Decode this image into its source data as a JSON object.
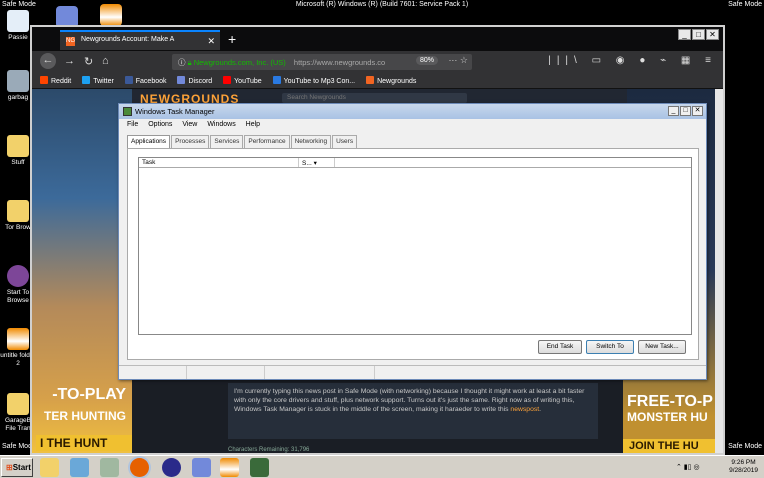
{
  "os": {
    "safe_mode": "Safe Mode",
    "build": "Microsoft (R) Windows (R) (Build 7601: Service Pack 1)"
  },
  "desktop_icons": [
    {
      "label": "Passie",
      "icon": "desktop-app-icon"
    },
    {
      "label": "garbag",
      "icon": "recycle-bin-icon"
    },
    {
      "label": "Stuff",
      "icon": "folder-icon"
    },
    {
      "label": "Tor Brow",
      "icon": "tor-browser-icon"
    },
    {
      "label": "Start To Browse",
      "icon": "tor-start-icon"
    },
    {
      "label": "untitle folder 2",
      "icon": "vlc-icon"
    },
    {
      "label": "GarageB File Tran",
      "icon": "folder-icon"
    }
  ],
  "firefox": {
    "tab_title": "Newgrounds Account: Make A",
    "tab_favicon": "NG",
    "secure_label": "Newgrounds.com, Inc. (US)",
    "url": "https://www.newgrounds.co",
    "zoom": "80%",
    "bookmarks": [
      {
        "label": "Reddit",
        "color": "#ff4500"
      },
      {
        "label": "Twitter",
        "color": "#1da1f2"
      },
      {
        "label": "Facebook",
        "color": "#3b5998"
      },
      {
        "label": "Discord",
        "color": "#7289da"
      },
      {
        "label": "YouTube",
        "color": "#ff0000"
      },
      {
        "label": "YouTube to Mp3 Con...",
        "color": "#2a7ae2"
      },
      {
        "label": "Newgrounds",
        "color": "#f26522"
      }
    ]
  },
  "page": {
    "logo": "NEWGROUNDS",
    "search_placeholder": "Search Newgrounds",
    "promo_left": [
      "-TO-PLAY",
      "TER HUNTING",
      "I THE HUNT"
    ],
    "promo_right": [
      "FREE-TO-P",
      "MONSTER HU",
      "JOIN THE HU"
    ],
    "news_text": "I'm currently typing this news post in Safe Mode (with networking) because I thought it might work at least a bit faster with only the core drivers and stuff, plus network support. Turns out it's just the same. Right now as of writing this, Windows Task Manager is stuck in the middle of the screen, making it haraeder to write this",
    "news_link": "newspost",
    "news_end": ".",
    "chars_remaining": "Characters Remaining: 31,796"
  },
  "taskmgr": {
    "title": "Windows Task Manager",
    "menu": [
      "File",
      "Options",
      "View",
      "Windows",
      "Help"
    ],
    "tabs": [
      "Applications",
      "Processes",
      "Services",
      "Performance",
      "Networking",
      "Users"
    ],
    "columns": [
      "Task",
      "S..."
    ],
    "buttons": {
      "end_task": "End Task",
      "switch_to": "Switch To",
      "new_task": "New Task..."
    }
  },
  "taskbar": {
    "start": "Start",
    "time": "9:26 PM",
    "date": "9/28/2019"
  }
}
